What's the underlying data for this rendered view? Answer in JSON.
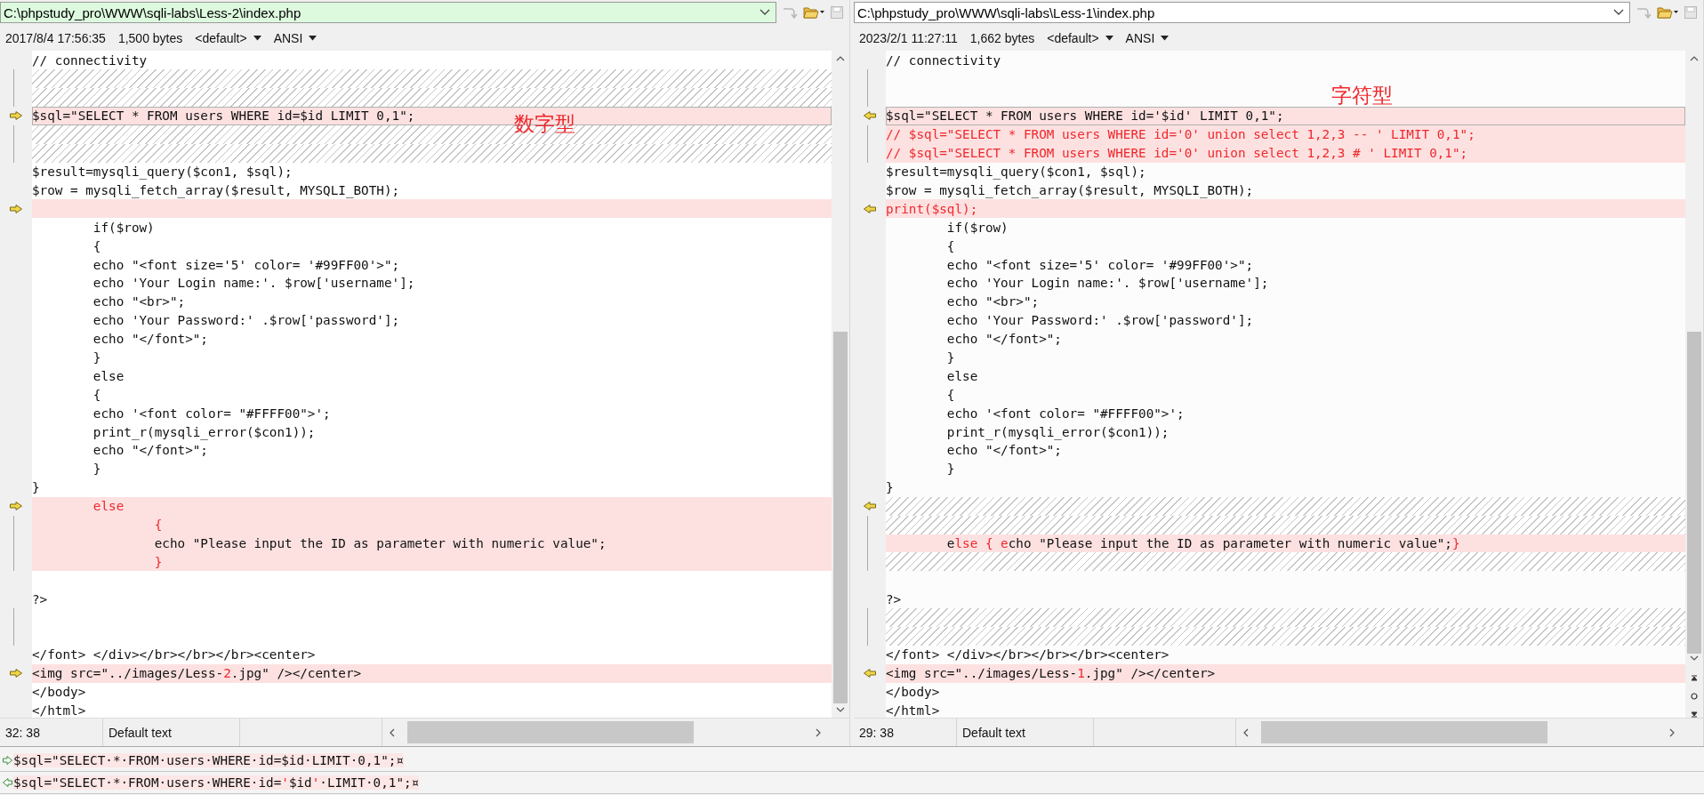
{
  "panes": [
    {
      "kind": "left",
      "active": true,
      "path": "C:\\phpstudy_pro\\WWW\\sqli-labs\\Less-2\\index.php",
      "date": "2017/8/4 17:56:35",
      "size": "1,500 bytes",
      "encoding_profile": "<default>",
      "charset": "ANSI",
      "annotations": [
        {
          "text": "数字型"
        }
      ],
      "rows": [
        {
          "kind": "code",
          "diff": false,
          "selected": false,
          "arrow": false,
          "bracket": false,
          "segments": [
            {
              "text": "// connectivity",
              "changed": false
            }
          ]
        },
        {
          "kind": "filler",
          "diff": false,
          "selected": false,
          "arrow": false,
          "bracket": true
        },
        {
          "kind": "filler",
          "diff": false,
          "selected": false,
          "arrow": false,
          "bracket": true
        },
        {
          "kind": "code",
          "diff": true,
          "selected": true,
          "arrow": true,
          "bracket": false,
          "segments": [
            {
              "text": "$sql=\"SELECT * FROM users WHERE id=$id LIMIT 0,1\";",
              "changed": false
            }
          ]
        },
        {
          "kind": "filler",
          "diff": false,
          "selected": false,
          "arrow": false,
          "bracket": true
        },
        {
          "kind": "filler",
          "diff": false,
          "selected": false,
          "arrow": false,
          "bracket": true
        },
        {
          "kind": "code",
          "diff": false,
          "selected": false,
          "arrow": false,
          "bracket": false,
          "segments": [
            {
              "text": "$result=mysqli_query($con1, $sql);",
              "changed": false
            }
          ]
        },
        {
          "kind": "code",
          "diff": false,
          "selected": false,
          "arrow": false,
          "bracket": false,
          "segments": [
            {
              "text": "$row = mysqli_fetch_array($result, MYSQLI_BOTH);",
              "changed": false
            }
          ]
        },
        {
          "kind": "code",
          "diff": true,
          "selected": false,
          "arrow": true,
          "bracket": false
        },
        {
          "kind": "code",
          "diff": false,
          "selected": false,
          "arrow": false,
          "bracket": false,
          "segments": [
            {
              "text": "        if($row)",
              "changed": false
            }
          ]
        },
        {
          "kind": "code",
          "diff": false,
          "selected": false,
          "arrow": false,
          "bracket": false,
          "segments": [
            {
              "text": "        {",
              "changed": false
            }
          ]
        },
        {
          "kind": "code",
          "diff": false,
          "selected": false,
          "arrow": false,
          "bracket": false,
          "segments": [
            {
              "text": "        echo \"<font size='5' color= '#99FF00'>\";",
              "changed": false
            }
          ]
        },
        {
          "kind": "code",
          "diff": false,
          "selected": false,
          "arrow": false,
          "bracket": false,
          "segments": [
            {
              "text": "        echo 'Your Login name:'. $row['username'];",
              "changed": false
            }
          ]
        },
        {
          "kind": "code",
          "diff": false,
          "selected": false,
          "arrow": false,
          "bracket": false,
          "segments": [
            {
              "text": "        echo \"<br>\";",
              "changed": false
            }
          ]
        },
        {
          "kind": "code",
          "diff": false,
          "selected": false,
          "arrow": false,
          "bracket": false,
          "segments": [
            {
              "text": "        echo 'Your Password:' .$row['password'];",
              "changed": false
            }
          ]
        },
        {
          "kind": "code",
          "diff": false,
          "selected": false,
          "arrow": false,
          "bracket": false,
          "segments": [
            {
              "text": "        echo \"</font>\";",
              "changed": false
            }
          ]
        },
        {
          "kind": "code",
          "diff": false,
          "selected": false,
          "arrow": false,
          "bracket": false,
          "segments": [
            {
              "text": "        }",
              "changed": false
            }
          ]
        },
        {
          "kind": "code",
          "diff": false,
          "selected": false,
          "arrow": false,
          "bracket": false,
          "segments": [
            {
              "text": "        else",
              "changed": false
            }
          ]
        },
        {
          "kind": "code",
          "diff": false,
          "selected": false,
          "arrow": false,
          "bracket": false,
          "segments": [
            {
              "text": "        {",
              "changed": false
            }
          ]
        },
        {
          "kind": "code",
          "diff": false,
          "selected": false,
          "arrow": false,
          "bracket": false,
          "segments": [
            {
              "text": "        echo '<font color= \"#FFFF00\">';",
              "changed": false
            }
          ]
        },
        {
          "kind": "code",
          "diff": false,
          "selected": false,
          "arrow": false,
          "bracket": false,
          "segments": [
            {
              "text": "        print_r(mysqli_error($con1));",
              "changed": false
            }
          ]
        },
        {
          "kind": "code",
          "diff": false,
          "selected": false,
          "arrow": false,
          "bracket": false,
          "segments": [
            {
              "text": "        echo \"</font>\";",
              "changed": false
            }
          ]
        },
        {
          "kind": "code",
          "diff": false,
          "selected": false,
          "arrow": false,
          "bracket": false,
          "segments": [
            {
              "text": "        }",
              "changed": false
            }
          ]
        },
        {
          "kind": "code",
          "diff": false,
          "selected": false,
          "arrow": false,
          "bracket": false,
          "segments": [
            {
              "text": "}",
              "changed": false
            }
          ]
        },
        {
          "kind": "code",
          "diff": true,
          "selected": false,
          "arrow": true,
          "bracket": false,
          "segments": [
            {
              "text": "        else",
              "changed": true
            }
          ]
        },
        {
          "kind": "code",
          "diff": true,
          "selected": false,
          "arrow": false,
          "bracket": true,
          "segments": [
            {
              "text": "                {",
              "changed": true
            }
          ]
        },
        {
          "kind": "code",
          "diff": true,
          "selected": false,
          "arrow": false,
          "bracket": true,
          "segments": [
            {
              "text": "                echo \"Please input the ID as parameter with numeric value\";",
              "changed": false
            }
          ]
        },
        {
          "kind": "code",
          "diff": true,
          "selected": false,
          "arrow": false,
          "bracket": true,
          "segments": [
            {
              "text": "                }",
              "changed": true
            }
          ]
        },
        {
          "kind": "code",
          "diff": false,
          "selected": false,
          "arrow": false,
          "bracket": false
        },
        {
          "kind": "code",
          "diff": false,
          "selected": false,
          "arrow": false,
          "bracket": false,
          "segments": [
            {
              "text": "?>",
              "changed": false
            }
          ]
        },
        {
          "kind": "code",
          "diff": false,
          "selected": false,
          "arrow": false,
          "bracket": true
        },
        {
          "kind": "code",
          "diff": false,
          "selected": false,
          "arrow": false,
          "bracket": true
        },
        {
          "kind": "code",
          "diff": false,
          "selected": false,
          "arrow": false,
          "bracket": false,
          "segments": [
            {
              "text": "</font> </div></br></br></br><center>",
              "changed": false
            }
          ]
        },
        {
          "kind": "code",
          "diff": true,
          "selected": false,
          "arrow": true,
          "bracket": false,
          "segments": [
            {
              "text": "<img src=\"../images/Less-",
              "changed": false
            },
            {
              "text": "2",
              "changed": true
            },
            {
              "text": ".jpg\" /></center>",
              "changed": false
            }
          ]
        },
        {
          "kind": "code",
          "diff": false,
          "selected": false,
          "arrow": false,
          "bracket": false,
          "segments": [
            {
              "text": "</body>",
              "changed": false
            }
          ]
        },
        {
          "kind": "code",
          "diff": false,
          "selected": false,
          "arrow": false,
          "bracket": false,
          "segments": [
            {
              "text": "</html>",
              "changed": false
            }
          ]
        }
      ],
      "status": {
        "position": "32: 38",
        "style": "Default text"
      }
    },
    {
      "kind": "right",
      "active": false,
      "path": "C:\\phpstudy_pro\\WWW\\sqli-labs\\Less-1\\index.php",
      "date": "2023/2/1 11:27:11",
      "size": "1,662 bytes",
      "encoding_profile": "<default>",
      "charset": "ANSI",
      "annotations": [
        {
          "text": "字符型"
        }
      ],
      "rows": [
        {
          "kind": "code",
          "diff": false,
          "selected": false,
          "arrow": false,
          "bracket": false,
          "segments": [
            {
              "text": "// connectivity",
              "changed": false
            }
          ]
        },
        {
          "kind": "code",
          "diff": false,
          "selected": false,
          "arrow": false,
          "bracket": true
        },
        {
          "kind": "code",
          "diff": false,
          "selected": false,
          "arrow": false,
          "bracket": true
        },
        {
          "kind": "code",
          "diff": true,
          "selected": true,
          "arrow": true,
          "bracket": false,
          "segments": [
            {
              "text": "$sql=\"SELECT * FROM users WHERE id='$id' LIMIT 0,1\";",
              "changed": false
            }
          ]
        },
        {
          "kind": "code",
          "diff": true,
          "selected": false,
          "arrow": false,
          "bracket": true,
          "segments": [
            {
              "text": "// $sql=\"SELECT * FROM users WHERE id='0' union select 1,2,3 -- ' LIMIT 0,1\";",
              "changed": true
            }
          ]
        },
        {
          "kind": "code",
          "diff": true,
          "selected": false,
          "arrow": false,
          "bracket": true,
          "segments": [
            {
              "text": "// $sql=\"SELECT * FROM users WHERE id='0' union select 1,2,3 # ' LIMIT 0,1\";",
              "changed": true
            }
          ]
        },
        {
          "kind": "code",
          "diff": false,
          "selected": false,
          "arrow": false,
          "bracket": false,
          "segments": [
            {
              "text": "$result=mysqli_query($con1, $sql);",
              "changed": false
            }
          ]
        },
        {
          "kind": "code",
          "diff": false,
          "selected": false,
          "arrow": false,
          "bracket": false,
          "segments": [
            {
              "text": "$row = mysqli_fetch_array($result, MYSQLI_BOTH);",
              "changed": false
            }
          ]
        },
        {
          "kind": "code",
          "diff": true,
          "selected": false,
          "arrow": true,
          "bracket": false,
          "segments": [
            {
              "text": "print($sql);",
              "changed": true
            }
          ]
        },
        {
          "kind": "code",
          "diff": false,
          "selected": false,
          "arrow": false,
          "bracket": false,
          "segments": [
            {
              "text": "        if($row)",
              "changed": false
            }
          ]
        },
        {
          "kind": "code",
          "diff": false,
          "selected": false,
          "arrow": false,
          "bracket": false,
          "segments": [
            {
              "text": "        {",
              "changed": false
            }
          ]
        },
        {
          "kind": "code",
          "diff": false,
          "selected": false,
          "arrow": false,
          "bracket": false,
          "segments": [
            {
              "text": "        echo \"<font size='5' color= '#99FF00'>\";",
              "changed": false
            }
          ]
        },
        {
          "kind": "code",
          "diff": false,
          "selected": false,
          "arrow": false,
          "bracket": false,
          "segments": [
            {
              "text": "        echo 'Your Login name:'. $row['username'];",
              "changed": false
            }
          ]
        },
        {
          "kind": "code",
          "diff": false,
          "selected": false,
          "arrow": false,
          "bracket": false,
          "segments": [
            {
              "text": "        echo \"<br>\";",
              "changed": false
            }
          ]
        },
        {
          "kind": "code",
          "diff": false,
          "selected": false,
          "arrow": false,
          "bracket": false,
          "segments": [
            {
              "text": "        echo 'Your Password:' .$row['password'];",
              "changed": false
            }
          ]
        },
        {
          "kind": "code",
          "diff": false,
          "selected": false,
          "arrow": false,
          "bracket": false,
          "segments": [
            {
              "text": "        echo \"</font>\";",
              "changed": false
            }
          ]
        },
        {
          "kind": "code",
          "diff": false,
          "selected": false,
          "arrow": false,
          "bracket": false,
          "segments": [
            {
              "text": "        }",
              "changed": false
            }
          ]
        },
        {
          "kind": "code",
          "diff": false,
          "selected": false,
          "arrow": false,
          "bracket": false,
          "segments": [
            {
              "text": "        else",
              "changed": false
            }
          ]
        },
        {
          "kind": "code",
          "diff": false,
          "selected": false,
          "arrow": false,
          "bracket": false,
          "segments": [
            {
              "text": "        {",
              "changed": false
            }
          ]
        },
        {
          "kind": "code",
          "diff": false,
          "selected": false,
          "arrow": false,
          "bracket": false,
          "segments": [
            {
              "text": "        echo '<font color= \"#FFFF00\">';",
              "changed": false
            }
          ]
        },
        {
          "kind": "code",
          "diff": false,
          "selected": false,
          "arrow": false,
          "bracket": false,
          "segments": [
            {
              "text": "        print_r(mysqli_error($con1));",
              "changed": false
            }
          ]
        },
        {
          "kind": "code",
          "diff": false,
          "selected": false,
          "arrow": false,
          "bracket": false,
          "segments": [
            {
              "text": "        echo \"</font>\";",
              "changed": false
            }
          ]
        },
        {
          "kind": "code",
          "diff": false,
          "selected": false,
          "arrow": false,
          "bracket": false,
          "segments": [
            {
              "text": "        }",
              "changed": false
            }
          ]
        },
        {
          "kind": "code",
          "diff": false,
          "selected": false,
          "arrow": false,
          "bracket": false,
          "segments": [
            {
              "text": "}",
              "changed": false
            }
          ]
        },
        {
          "kind": "filler",
          "diff": false,
          "selected": false,
          "arrow": true,
          "bracket": false
        },
        {
          "kind": "filler",
          "diff": false,
          "selected": false,
          "arrow": false,
          "bracket": true
        },
        {
          "kind": "code",
          "diff": true,
          "selected": false,
          "arrow": false,
          "bracket": true,
          "segments": [
            {
              "text": "        e",
              "changed": false
            },
            {
              "text": "lse { e",
              "changed": true
            },
            {
              "text": "cho \"Please input the ID as parameter with numeric value\";",
              "changed": false
            },
            {
              "text": "}",
              "changed": true
            }
          ]
        },
        {
          "kind": "filler",
          "diff": false,
          "selected": false,
          "arrow": false,
          "bracket": true
        },
        {
          "kind": "code",
          "diff": false,
          "selected": false,
          "arrow": false,
          "bracket": false
        },
        {
          "kind": "code",
          "diff": false,
          "selected": false,
          "arrow": false,
          "bracket": false,
          "segments": [
            {
              "text": "?>",
              "changed": false
            }
          ]
        },
        {
          "kind": "filler",
          "diff": false,
          "selected": false,
          "arrow": false,
          "bracket": true
        },
        {
          "kind": "filler",
          "diff": false,
          "selected": false,
          "arrow": false,
          "bracket": true
        },
        {
          "kind": "code",
          "diff": false,
          "selected": false,
          "arrow": false,
          "bracket": false,
          "segments": [
            {
              "text": "</font> </div></br></br></br><center>",
              "changed": false
            }
          ]
        },
        {
          "kind": "code",
          "diff": true,
          "selected": false,
          "arrow": true,
          "bracket": false,
          "segments": [
            {
              "text": "<img src=\"../images/Less-",
              "changed": false
            },
            {
              "text": "1",
              "changed": true
            },
            {
              "text": ".jpg\" /></center>",
              "changed": false
            }
          ]
        },
        {
          "kind": "code",
          "diff": false,
          "selected": false,
          "arrow": false,
          "bracket": false,
          "segments": [
            {
              "text": "</body>",
              "changed": false
            }
          ]
        },
        {
          "kind": "code",
          "diff": false,
          "selected": false,
          "arrow": false,
          "bracket": false,
          "segments": [
            {
              "text": "</html>",
              "changed": false
            }
          ]
        }
      ],
      "status": {
        "position": "29: 38",
        "style": "Default text"
      }
    }
  ],
  "detail_lines": [
    {
      "kind": "left",
      "segments": [
        {
          "text": "$sql=\"SELECT·*·FROM·users·WHERE·id=$id·LIMIT·0,1\";¤",
          "changed": false
        }
      ]
    },
    {
      "kind": "right",
      "segments": [
        {
          "text": "$sql=\"SELECT·*·FROM·users·WHERE·id=",
          "changed": false
        },
        {
          "text": "'",
          "changed": true
        },
        {
          "text": "$id",
          "changed": false
        },
        {
          "text": "'",
          "changed": true
        },
        {
          "text": "·LIMIT·0,1\";¤",
          "changed": false
        }
      ]
    }
  ]
}
